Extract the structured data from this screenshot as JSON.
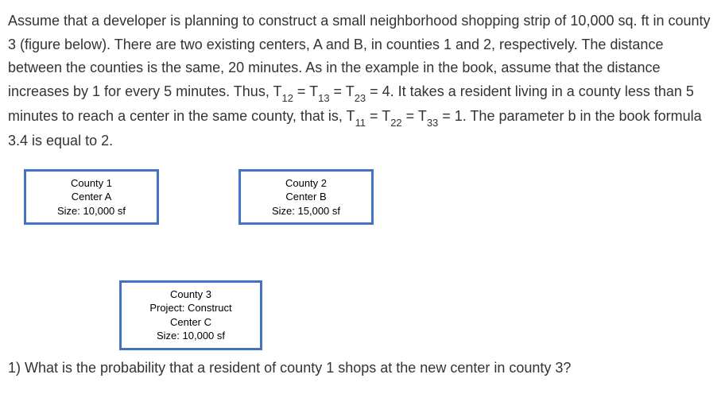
{
  "problem": {
    "text_parts": [
      "Assume that a developer is planning to construct a small neighborhood shopping strip of 10,000 sq. ft in county 3 (figure below). There are two existing centers, A and B, in counties 1 and 2, respectively. The distance between the counties is the same, 20 minutes. As in the example in the book, assume that the distance increases by 1 for every 5 minutes. Thus, T",
      " = T",
      " = T",
      " = 4. It takes a resident living in a county less than 5 minutes to reach a center in the same county, that is, T",
      " = T",
      " = T",
      " = 1. The parameter b in the book formula 3.4 is equal to 2."
    ],
    "subs": [
      "12",
      "13",
      "23",
      "11",
      "22",
      "33"
    ]
  },
  "counties": {
    "county1": {
      "title": "County 1",
      "center": "Center A",
      "size": "Size: 10,000 sf"
    },
    "county2": {
      "title": "County 2",
      "center": "Center B",
      "size": "Size: 15,000 sf"
    },
    "county3": {
      "title": "County 3",
      "project": "Project: Construct",
      "center": "Center C",
      "size": "Size: 10,000 sf"
    }
  },
  "question": "1) What is the probability that a resident of county 1 shops at the new center in county 3?"
}
